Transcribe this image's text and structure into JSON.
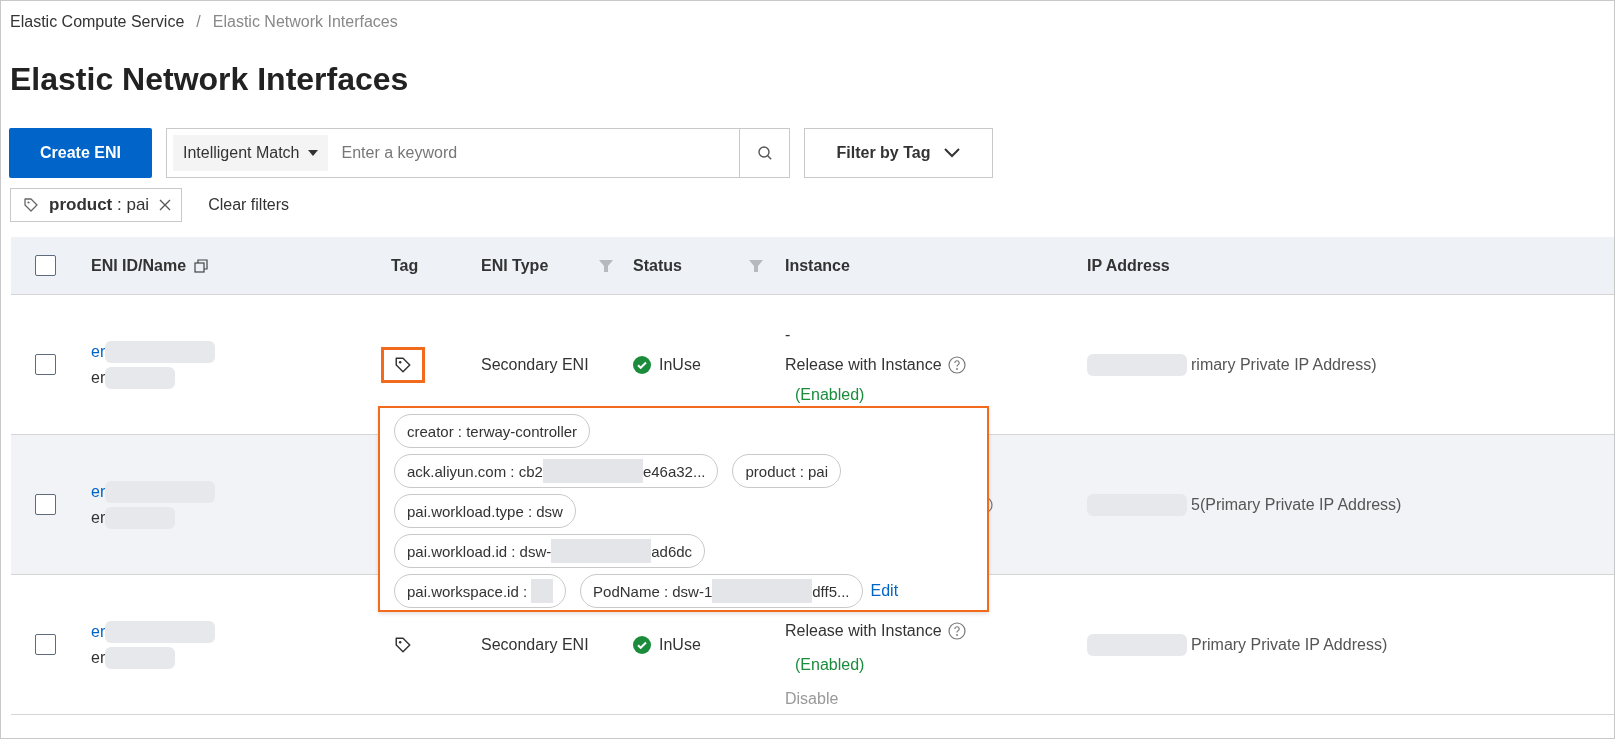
{
  "breadcrumb": [
    {
      "label": "Elastic Compute Service",
      "current": false
    },
    {
      "label": "Elastic Network Interfaces",
      "current": true
    }
  ],
  "breadcrumb_separator": "/",
  "title": "Elastic Network Interfaces",
  "toolbar": {
    "create_button": "Create ENI",
    "match_select": "Intelligent Match",
    "search": {
      "placeholder": "Enter a keyword"
    },
    "filter_button": "Filter by Tag"
  },
  "active_filter": "**product** : pai",
  "clear_filters": "Clear filters",
  "table": {
    "header_checked": false,
    "columns": [
      {
        "label": "ENI ID/Name",
        "kind": "copy"
      },
      {
        "label": "Tag",
        "kind": "plain"
      },
      {
        "label": "ENI Type",
        "kind": "filter"
      },
      {
        "label": "Status",
        "kind": "filter"
      },
      {
        "label": "Instance",
        "kind": "plain"
      },
      {
        "label": "IP Address",
        "kind": "plain"
      }
    ],
    "rows": [
      {
        "checked": false,
        "hovered": false,
        "id_prefix": "er",
        "name_prefix": "er",
        "tag_highlighted": true,
        "type": "Secondary ENI",
        "status": "InUse",
        "instance": {
          "dash": "-",
          "release": "Release with Instance",
          "enabled": "(Enabled)"
        },
        "ip_suffix": "rimary Private IP Address)"
      },
      {
        "checked": false,
        "hovered": true,
        "id_prefix": "er",
        "name_prefix": "er",
        "ip_suffix": "5(Primary Private IP Address)"
      },
      {
        "checked": false,
        "hovered": false,
        "id_prefix": "er",
        "name_prefix": "er",
        "tag_highlighted": false,
        "type": "Secondary ENI",
        "status": "InUse",
        "instance": {
          "release": "Release with Instance",
          "enabled": "(Enabled)",
          "disable": "Disable"
        },
        "ip_suffix": "Primary Private IP Address)"
      }
    ]
  },
  "tag_popup": {
    "lines": [
      [
        {
          "prefix": "creator : terway-controller",
          "kind": "plain"
        }
      ],
      [
        {
          "prefix": "ack.aliyun.com : cb2",
          "kind": "redacted",
          "suffix": "e46a32..."
        },
        {
          "prefix": "product : pai",
          "kind": "plain"
        }
      ],
      [
        {
          "prefix": "pai.workload.type : dsw",
          "kind": "plain"
        }
      ],
      [
        {
          "prefix": "pai.workload.id : dsw-",
          "kind": "redacted",
          "suffix": "ad6dc"
        }
      ],
      [
        {
          "prefix": "pai.workspace.id :",
          "kind": "redacted"
        },
        {
          "prefix": "PodName : dsw-1",
          "kind": "redacted",
          "suffix": "dff5..."
        }
      ]
    ],
    "edit": "Edit"
  }
}
